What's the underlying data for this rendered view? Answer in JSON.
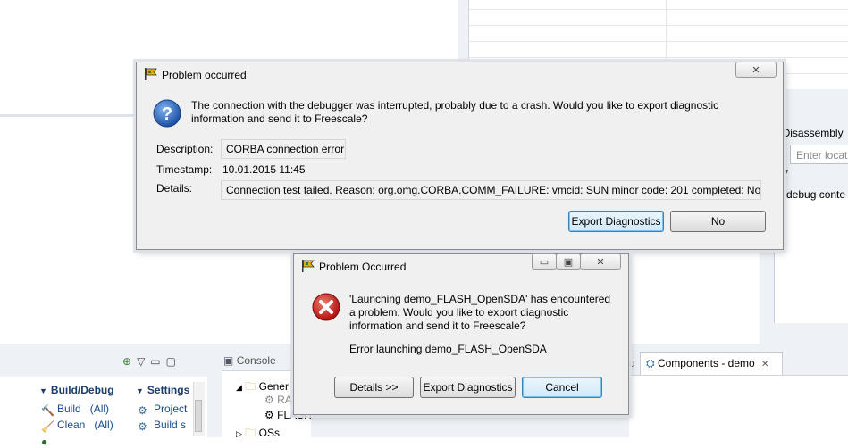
{
  "dialog_main": {
    "title": "Problem occurred",
    "message": "The connection with the debugger was interrupted, probably due to a crash. Would you like to export diagnostic information and send it to Freescale?",
    "description_label": "Description:",
    "description_value": "CORBA connection error",
    "timestamp_label": "Timestamp:",
    "timestamp_value": "10.01.2015 11:45",
    "details_label": "Details:",
    "details_value": "Connection test failed. Reason: org.omg.CORBA.COMM_FAILURE:   vmcid: SUN  minor code: 201  completed: No",
    "export_label": "Export Diagnostics",
    "no_label": "No",
    "close_glyph": "✕"
  },
  "dialog_second": {
    "title": "Problem Occurred",
    "message": "'Launching demo_FLASH_OpenSDA' has encountered a problem. Would you like to export diagnostic information and send it to Freescale?",
    "error_line": "Error launching demo_FLASH_OpenSDA",
    "details_label": "Details >>",
    "export_label": "Export Diagnostics",
    "cancel_label": "Cancel",
    "minimize_glyph": "▭",
    "restore_glyph": "▣",
    "close_glyph": "✕"
  },
  "ide": {
    "disassembly_title": "Disassembly",
    "disassembly_placeholder": "Enter locati",
    "no_debug_context": "o debug conte",
    "left_view": {
      "build_debug_header": "Build/Debug",
      "settings_header": "Settings",
      "build_label": "Build",
      "build_all": "(All)",
      "clean_label": "Clean",
      "clean_all": "(All)",
      "project_label": "Project",
      "build_s_label": "Build s"
    },
    "console_tab": "Console",
    "console_tree": {
      "generic": "Gener",
      "ra": "RA",
      "flash": "FLASH",
      "oss": "OSs"
    },
    "partial_tab_text": "u",
    "components_tab": "Components - demo",
    "components_close": "✕"
  },
  "colors": {
    "dialog_bg": "#f0f0f0",
    "default_button_border": "#3c7fb1",
    "ide_chrome": "#eef1f5",
    "link_blue": "#1a4a8a"
  }
}
